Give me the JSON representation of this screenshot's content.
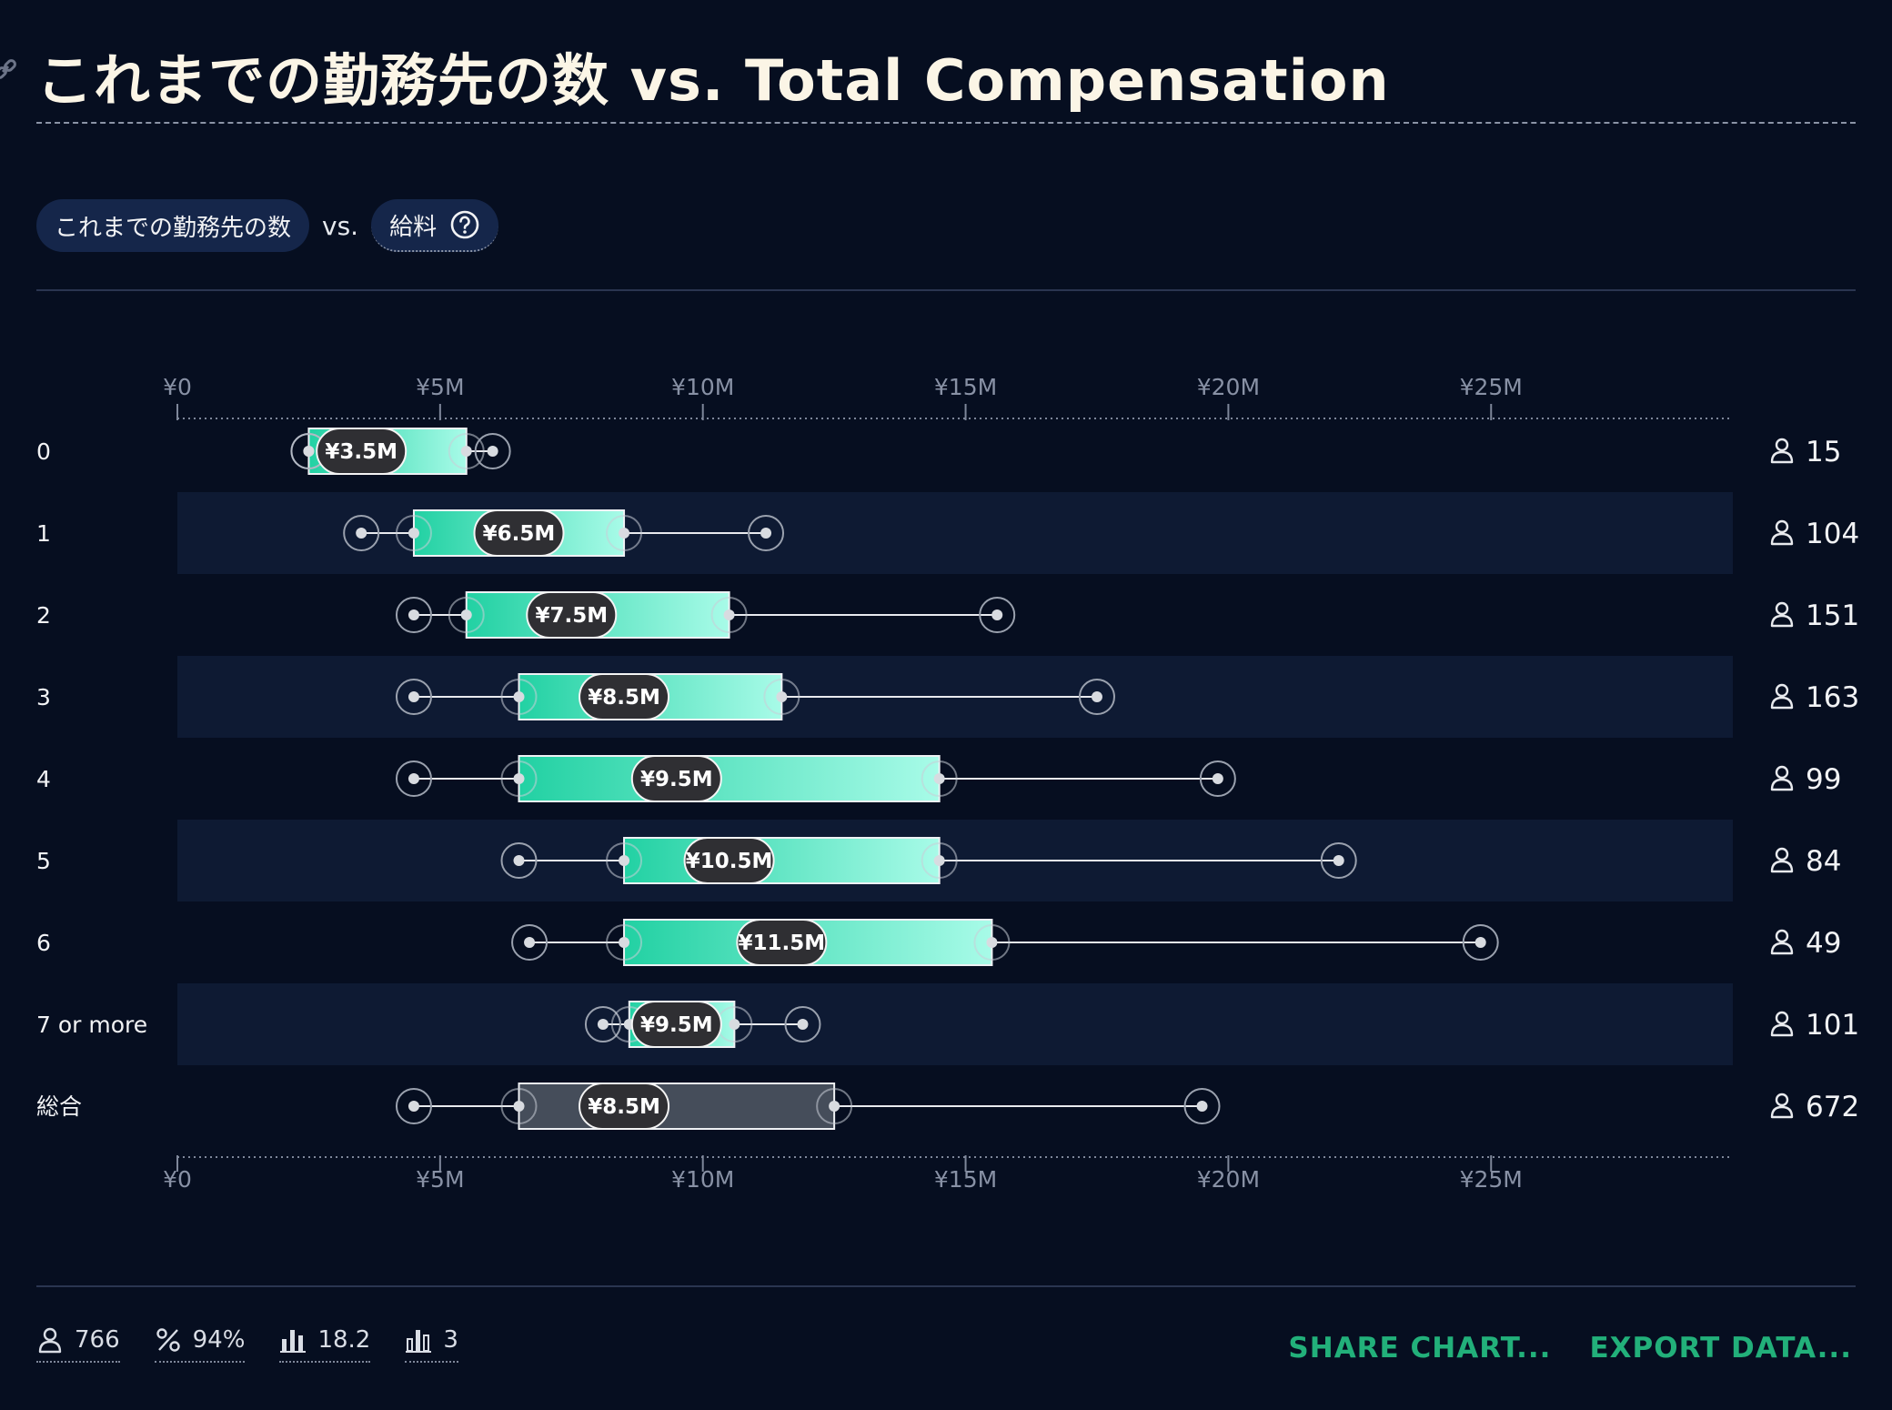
{
  "title": "これまでの勤務先の数 vs. Total Compensation",
  "filters": {
    "pill_left": "これまでの勤務先の数",
    "vs": "vs.",
    "pill_right": "給料",
    "help_icon": "question-circle-icon"
  },
  "colors": {
    "background": "#060e20",
    "band": "#0e1a33",
    "box_gradient_start": "#22d1a3",
    "box_gradient_end": "#a8fbe8",
    "overall_box": "#454d5a",
    "action_text": "#22b07a"
  },
  "chart_data": {
    "type": "boxplot",
    "orientation": "horizontal",
    "x_ticks": [
      "¥0",
      "¥5M",
      "¥10M",
      "¥15M",
      "¥20M",
      "¥25M"
    ],
    "x_tick_values": [
      0,
      5,
      10,
      15,
      20,
      25
    ],
    "xlim": [
      0,
      29.6
    ],
    "unit": "¥M",
    "count_icon": "person-icon",
    "rows": [
      {
        "label": "0",
        "p10": 2.5,
        "q1": 2.5,
        "median": 3.5,
        "median_label": "¥3.5M",
        "q3": 5.5,
        "p90": 6.0,
        "count": "15"
      },
      {
        "label": "1",
        "p10": 3.5,
        "q1": 4.5,
        "median": 6.5,
        "median_label": "¥6.5M",
        "q3": 8.5,
        "p90": 11.2,
        "count": "104"
      },
      {
        "label": "2",
        "p10": 4.5,
        "q1": 5.5,
        "median": 7.5,
        "median_label": "¥7.5M",
        "q3": 10.5,
        "p90": 15.6,
        "count": "151"
      },
      {
        "label": "3",
        "p10": 4.5,
        "q1": 6.5,
        "median": 8.5,
        "median_label": "¥8.5M",
        "q3": 11.5,
        "p90": 17.5,
        "count": "163"
      },
      {
        "label": "4",
        "p10": 4.5,
        "q1": 6.5,
        "median": 9.5,
        "median_label": "¥9.5M",
        "q3": 14.5,
        "p90": 19.8,
        "count": "99"
      },
      {
        "label": "5",
        "p10": 6.5,
        "q1": 8.5,
        "median": 10.5,
        "median_label": "¥10.5M",
        "q3": 14.5,
        "p90": 22.1,
        "count": "84"
      },
      {
        "label": "6",
        "p10": 6.7,
        "q1": 8.5,
        "median": 11.5,
        "median_label": "¥11.5M",
        "q3": 15.5,
        "p90": 24.8,
        "count": "49"
      },
      {
        "label": "7 or more",
        "p10": 8.1,
        "q1": 8.6,
        "median": 9.5,
        "median_label": "¥9.5M",
        "q3": 10.6,
        "p90": 11.9,
        "count": "101"
      },
      {
        "label": "総合",
        "p10": 4.5,
        "q1": 6.5,
        "median": 8.5,
        "median_label": "¥8.5M",
        "q3": 12.5,
        "p90": 19.5,
        "count": "672",
        "overall": true
      }
    ]
  },
  "footer": {
    "stats": [
      {
        "icon": "person-icon",
        "value": "766"
      },
      {
        "icon": "percent-icon",
        "value": "94%"
      },
      {
        "icon": "bar-chart-icon",
        "value": "18.2"
      },
      {
        "icon": "bar-chart-outline-icon",
        "value": "3"
      }
    ],
    "share_label": "SHARE CHART...",
    "export_label": "EXPORT DATA..."
  }
}
